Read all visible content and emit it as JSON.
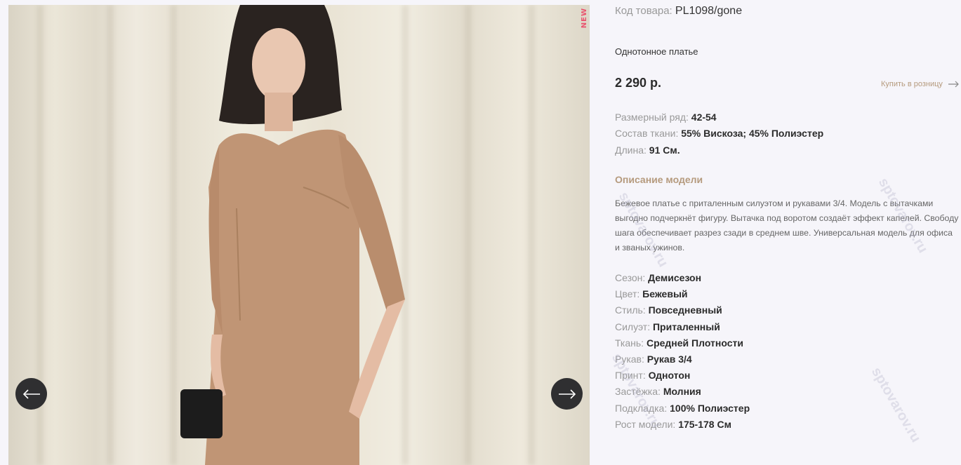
{
  "gallery": {
    "badge": "NEW",
    "prev_icon": "arrow-left-icon",
    "next_icon": "arrow-right-icon"
  },
  "product": {
    "sku_label": "Код товара:",
    "sku_value": "PL1098/gone",
    "name": "Однотонное платье",
    "price": "2 290 р.",
    "retail_link": "Купить в розницу",
    "size_label": "Размерный ряд:",
    "size_value": "42-54",
    "fabric_label": "Состав ткани:",
    "fabric_value": "55% Вискоза; 45% Полиэстер",
    "length_label": "Длина:",
    "length_value": "91 См.",
    "desc_title": "Описание модели",
    "description": "Бежевое платье с приталенным силуэтом и рукавами 3/4. Модель с вытачками выгодно подчеркнёт фигуру. Вытачка под воротом создаёт эффект капелей. Свободу шага обеспечивает разрез сзади в среднем шве. Универсальная модель для офиса и званых ужинов."
  },
  "attributes": [
    {
      "label": "Сезон:",
      "value": "Демисезон"
    },
    {
      "label": "Цвет:",
      "value": "Бежевый"
    },
    {
      "label": "Стиль:",
      "value": "Повседневный"
    },
    {
      "label": "Силуэт:",
      "value": "Приталенный"
    },
    {
      "label": "Ткань:",
      "value": "Средней Плотности"
    },
    {
      "label": "Рукав:",
      "value": "Рукав 3/4"
    },
    {
      "label": "Принт:",
      "value": "Однотон"
    },
    {
      "label": "Застёжка:",
      "value": "Молния"
    },
    {
      "label": "Подкладка:",
      "value": "100% Полиэстер"
    },
    {
      "label": "Рост модели:",
      "value": "175-178 См"
    }
  ],
  "watermark": "sptovarov.ru",
  "colors": {
    "accent": "#b59a7d",
    "badge": "#e9556f",
    "nav": "#2f2f31"
  }
}
